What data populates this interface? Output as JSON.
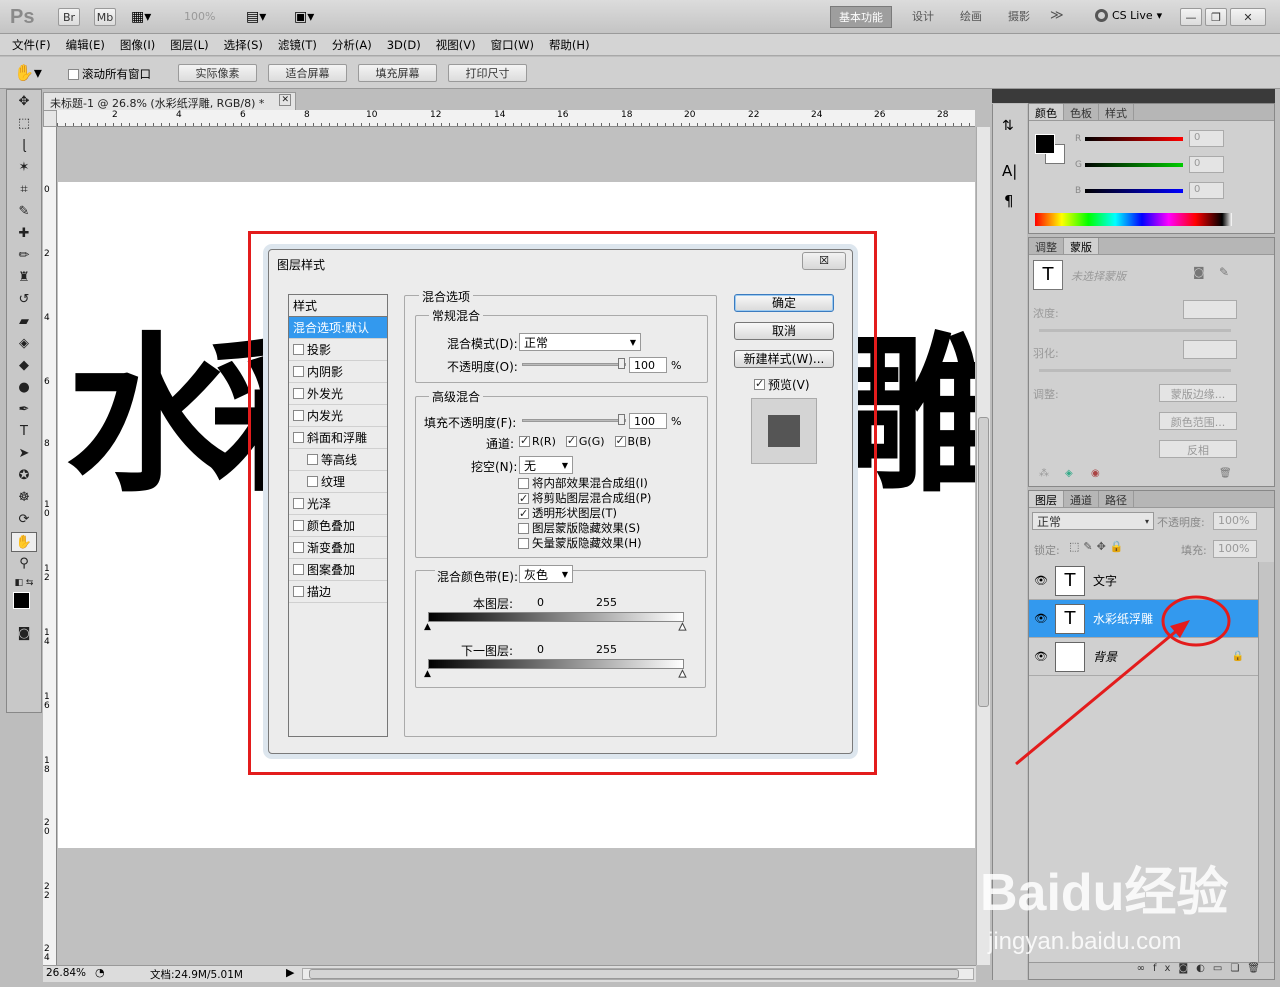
{
  "app": {
    "logo": "Ps",
    "bridge_btns": [
      "Br",
      "Mb"
    ],
    "zoom": "100%",
    "workspaces": [
      "基本功能",
      "设计",
      "绘画",
      "摄影"
    ],
    "active_workspace": "基本功能",
    "cslive": "CS Live"
  },
  "menu": [
    "文件(F)",
    "编辑(E)",
    "图像(I)",
    "图层(L)",
    "选择(S)",
    "滤镜(T)",
    "分析(A)",
    "3D(D)",
    "视图(V)",
    "窗口(W)",
    "帮助(H)"
  ],
  "options": {
    "scroll_all": "滚动所有窗口",
    "btn_actual": "实际像素",
    "btn_fit": "适合屏幕",
    "btn_fill": "填充屏幕",
    "btn_print": "打印尺寸"
  },
  "document": {
    "tab": "未标题-1 @ 26.8% (水彩纸浮雕, RGB/8) *",
    "canvas_text_left": "水",
    "canvas_text_right": "雕",
    "ruler_h": [
      "2",
      "4",
      "6",
      "8",
      "10",
      "12",
      "14",
      "16",
      "18",
      "20",
      "22",
      "24",
      "26",
      "28"
    ],
    "ruler_v": [
      "0",
      "2",
      "4",
      "6",
      "8",
      "1\n0",
      "1\n2",
      "1\n4",
      "1\n6",
      "1\n8",
      "2\n0",
      "2\n2",
      "2\n4"
    ]
  },
  "status": {
    "zoom": "26.84%",
    "doc": "文档:24.9M/5.01M"
  },
  "color_panel": {
    "tabs": [
      "颜色",
      "色板",
      "样式"
    ],
    "r_label": "R",
    "g_label": "G",
    "b_label": "B",
    "r": "0",
    "g": "0",
    "b": "0"
  },
  "mask_panel": {
    "tabs": [
      "调整",
      "蒙版"
    ],
    "no_mask": "未选择蒙版",
    "density": "浓度:",
    "feather": "羽化:",
    "refine": "调整:",
    "btn_edge": "蒙版边缘...",
    "btn_range": "颜色范围...",
    "btn_invert": "反相"
  },
  "layers_panel": {
    "tabs": [
      "图层",
      "通道",
      "路径"
    ],
    "blend": "正常",
    "opacity_label": "不透明度:",
    "opacity": "100%",
    "lock_label": "锁定:",
    "fill_label": "填充:",
    "fill": "100%",
    "layers": [
      {
        "name": "文字",
        "type": "T"
      },
      {
        "name": "水彩纸浮雕",
        "type": "T",
        "selected": true
      },
      {
        "name": "背景",
        "type": "bg"
      }
    ]
  },
  "dialog": {
    "title": "图层样式",
    "close": "☒",
    "styles_header": "样式",
    "styles": [
      {
        "label": "混合选项:默认",
        "on": true,
        "cb": false,
        "indent": false
      },
      {
        "label": "投影",
        "cb": true,
        "indent": false
      },
      {
        "label": "内阴影",
        "cb": true,
        "indent": false
      },
      {
        "label": "外发光",
        "cb": true,
        "indent": false
      },
      {
        "label": "内发光",
        "cb": true,
        "indent": false
      },
      {
        "label": "斜面和浮雕",
        "cb": true,
        "indent": false
      },
      {
        "label": "等高线",
        "cb": true,
        "indent": true
      },
      {
        "label": "纹理",
        "cb": true,
        "indent": true
      },
      {
        "label": "光泽",
        "cb": true,
        "indent": false
      },
      {
        "label": "颜色叠加",
        "cb": true,
        "indent": false
      },
      {
        "label": "渐变叠加",
        "cb": true,
        "indent": false
      },
      {
        "label": "图案叠加",
        "cb": true,
        "indent": false
      },
      {
        "label": "描边",
        "cb": true,
        "indent": false
      }
    ],
    "blend_options": "混合选项",
    "general": "常规混合",
    "blend_mode_label": "混合模式(D):",
    "blend_mode": "正常",
    "opacity_label": "不透明度(O):",
    "opacity": "100",
    "pct": "%",
    "advanced": "高级混合",
    "fill_label": "填充不透明度(F):",
    "fill": "100",
    "channels_label": "通道:",
    "ch_r": "R(R)",
    "ch_g": "G(G)",
    "ch_b": "B(B)",
    "knockout_label": "挖空(N):",
    "knockout": "无",
    "opt1": "将内部效果混合成组(I)",
    "opt2": "将剪贴图层混合成组(P)",
    "opt3": "透明形状图层(T)",
    "opt4": "图层蒙版隐藏效果(S)",
    "opt5": "矢量蒙版隐藏效果(H)",
    "blendif_label": "混合颜色带(E):",
    "blendif": "灰色",
    "this_layer": "本图层:",
    "under_layer": "下一图层:",
    "v0": "0",
    "v255": "255",
    "btn_ok": "确定",
    "btn_cancel": "取消",
    "btn_new": "新建样式(W)...",
    "preview": "预览(V)"
  },
  "watermark": {
    "main": "Baidu经验",
    "sub": "jingyan.baidu.com"
  }
}
